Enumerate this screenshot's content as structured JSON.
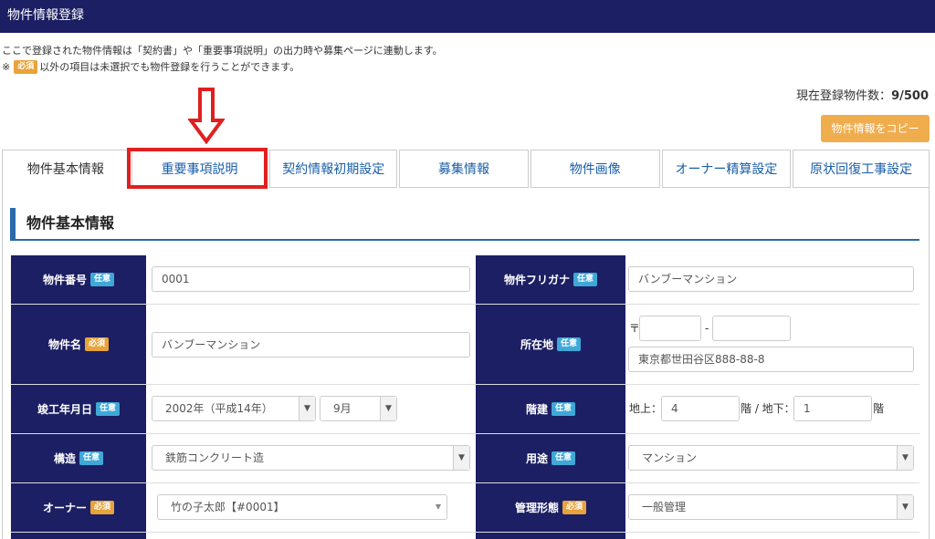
{
  "header": {
    "title": "物件情報登録"
  },
  "notice": {
    "line1": "ここで登録された物件情報は「契約書」や「重要事項説明」の出力時や募集ページに連動します。",
    "line2_prefix": "※",
    "line2_badge": "必須",
    "line2_text": "以外の項目は未選択でも物件登録を行うことができます。"
  },
  "count": {
    "label": "現在登録物件数：",
    "value": "9/500"
  },
  "copy_button": "物件情報をコピー",
  "tabs": [
    {
      "label": "物件基本情報"
    },
    {
      "label": "重要事項説明"
    },
    {
      "label": "契約情報初期設定"
    },
    {
      "label": "募集情報"
    },
    {
      "label": "物件画像"
    },
    {
      "label": "オーナー精算設定"
    },
    {
      "label": "原状回復工事設定"
    }
  ],
  "section_title": "物件基本情報",
  "badges": {
    "optional": "任意",
    "required": "必須"
  },
  "fields": {
    "property_no": {
      "label": "物件番号",
      "value": "0001"
    },
    "property_kana": {
      "label": "物件フリガナ",
      "value": "バンブーマンション"
    },
    "property_name": {
      "label": "物件名",
      "value": "バンブーマンション"
    },
    "address": {
      "label": "所在地",
      "zip_mark": "〒",
      "zip_sep": "-",
      "zip1": "",
      "zip2": "",
      "value": "東京都世田谷区888-88-8"
    },
    "built_date": {
      "label": "竣工年月日",
      "year": "2002年（平成14年）",
      "month": "9月"
    },
    "floors": {
      "label": "階建",
      "above_label": "地上：",
      "above": "4",
      "below_label": "階 / 地下：",
      "below": "1",
      "suffix": "階"
    },
    "structure": {
      "label": "構造",
      "value": "鉄筋コンクリート造"
    },
    "usage": {
      "label": "用途",
      "value": "マンション"
    },
    "owner": {
      "label": "オーナー",
      "value": "竹の子太郎【#0001】"
    },
    "management": {
      "label": "管理形態",
      "value": "一般管理"
    }
  },
  "colors": {
    "header_bg": "#1c1f63",
    "label_bg": "#1c1f63",
    "required_badge": "#e8a33a",
    "optional_badge": "#3fa8d8",
    "highlight": "#e02020",
    "copy_button": "#f0ad4e"
  }
}
